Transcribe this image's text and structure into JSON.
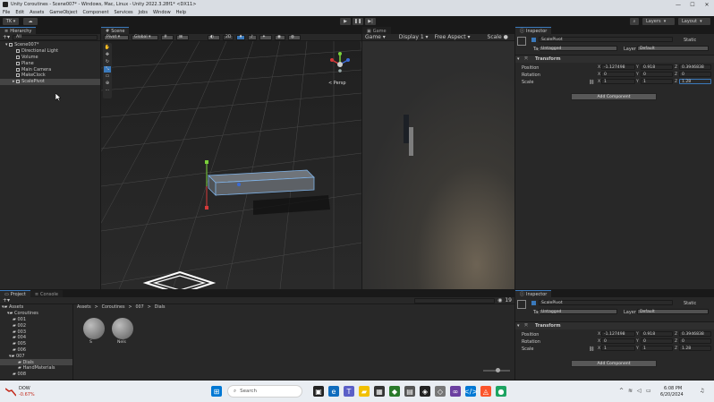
{
  "window": {
    "title": "Unity Coroutines - Scene007* - Windows, Mac, Linux - Unity 2022.3.28f1* <DX11>",
    "controls": [
      "—",
      "☐",
      "✕"
    ]
  },
  "menu": [
    "File",
    "Edit",
    "Assets",
    "GameObject",
    "Component",
    "Services",
    "Jobs",
    "Window",
    "Help"
  ],
  "toolbar": {
    "account": "TK",
    "layers": "Layers",
    "layout": "Layout"
  },
  "hierarchy": {
    "tab": "Hierarchy",
    "search_placeholder": "All",
    "scene": "Scene007*",
    "items": [
      "Directional Light",
      "Volume",
      "Plane",
      "Main Camera",
      "MakeClock",
      "ScalePivot"
    ]
  },
  "scene": {
    "tab": "Scene",
    "pivot": "Pivot",
    "global": "Global",
    "mode_2d": "2D",
    "persp": "< Persp"
  },
  "game": {
    "tab": "Game",
    "mode": "Game",
    "display": "Display 1",
    "aspect": "Free Aspect",
    "scale": "Scale"
  },
  "inspector_top": {
    "tab": "Inspector",
    "object_name": "ScalePivot",
    "static_label": "Static",
    "tag_label": "Tag",
    "tag_value": "Untagged",
    "layer_label": "Layer",
    "layer_value": "Default",
    "component": "Transform",
    "position_label": "Position",
    "rotation_label": "Rotation",
    "scale_label": "Scale",
    "position": {
      "x": "-1.127498",
      "y": "0.918",
      "z": "0.3946838"
    },
    "rotation": {
      "x": "0",
      "y": "0",
      "z": "0"
    },
    "scale": {
      "x": "1",
      "y": "1",
      "z": "1.28"
    },
    "add_component": "Add Component"
  },
  "inspector_bottom": {
    "tab": "Inspector",
    "object_name": "ScalePivot",
    "static_label": "Static",
    "tag_label": "Tag",
    "tag_value": "Untagged",
    "layer_label": "Layer",
    "layer_value": "Default",
    "component": "Transform",
    "position_label": "Position",
    "rotation_label": "Rotation",
    "scale_label": "Scale",
    "position": {
      "x": "-1.127498",
      "y": "0.918",
      "z": "0.3946838"
    },
    "rotation": {
      "x": "0",
      "y": "0",
      "z": "0"
    },
    "scale": {
      "x": "1",
      "y": "1",
      "z": "1.28"
    },
    "add_component": "Add Component"
  },
  "project": {
    "tab_project": "Project",
    "tab_console": "Console",
    "breadcrumb": [
      "Assets",
      "Coroutines",
      "007",
      "Dials"
    ],
    "hidden_count": "19",
    "tree": [
      "Assets",
      "Coroutines",
      "001",
      "002",
      "003",
      "004",
      "005",
      "006",
      "007",
      "Dials",
      "HandMaterials",
      "008"
    ],
    "assets": [
      "S",
      "Nels"
    ]
  },
  "taskbar": {
    "stock_name": "DOW",
    "stock_change": "-0.67%",
    "search_placeholder": "Search",
    "time": "6:08 PM",
    "date": "6/20/2024"
  },
  "colors": {
    "accent": "#3a79bb",
    "selection": "#2c5d87",
    "stock_down": "#c42b1c"
  }
}
